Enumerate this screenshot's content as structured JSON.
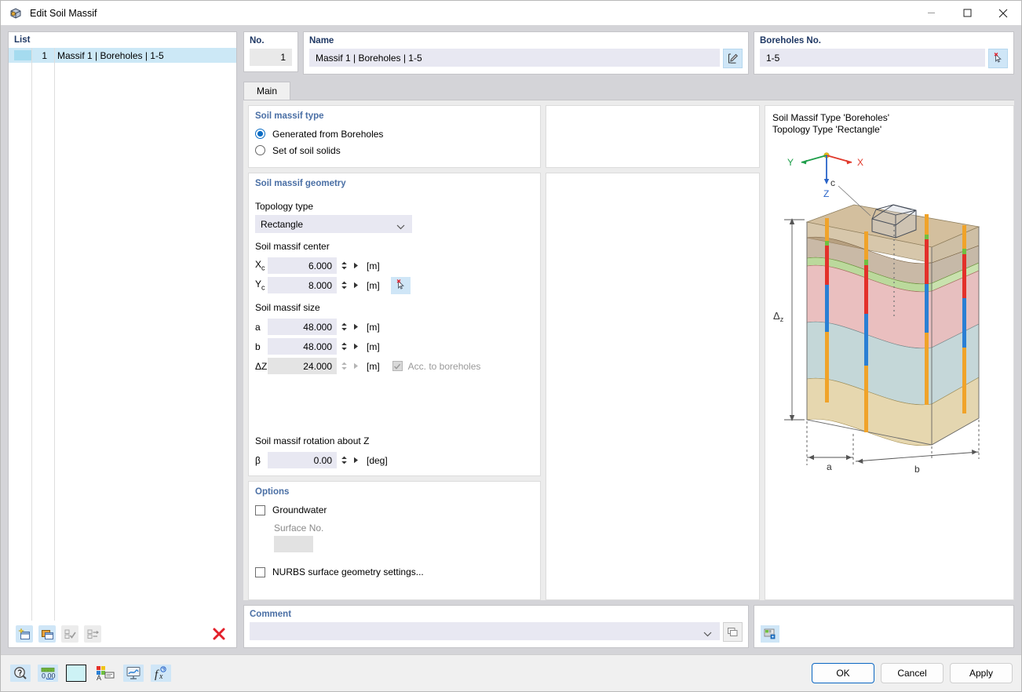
{
  "window": {
    "title": "Edit Soil Massif",
    "icon": "soil-massif-icon",
    "minimize": "—",
    "maximize": "□",
    "close": "✕"
  },
  "list": {
    "header": "List",
    "rows": [
      {
        "no": "1",
        "name": "Massif 1 | Boreholes | 1-5",
        "swatch": "#a5dbef"
      }
    ],
    "toolbar": [
      {
        "name": "new-item-button",
        "enabled": true
      },
      {
        "name": "copy-item-button",
        "enabled": true
      },
      {
        "name": "select-all-button",
        "enabled": false
      },
      {
        "name": "invert-selection-button",
        "enabled": false
      }
    ],
    "delete_button": "delete-item-button"
  },
  "header": {
    "no_label": "No.",
    "no_value": "1",
    "name_label": "Name",
    "name_value": "Massif 1 | Boreholes | 1-5",
    "name_edit_button": "edit-name-button",
    "boreholes_label": "Boreholes No.",
    "boreholes_value": "1-5",
    "boreholes_pick_button": "pick-boreholes-button"
  },
  "tabs": [
    {
      "label": "Main",
      "active": true
    }
  ],
  "soil_massif_type": {
    "title": "Soil massif type",
    "options": [
      {
        "label": "Generated from Boreholes",
        "selected": true
      },
      {
        "label": "Set of soil solids",
        "selected": false
      }
    ]
  },
  "geometry": {
    "title": "Soil massif geometry",
    "topology_label": "Topology type",
    "topology_value": "Rectangle",
    "center_label": "Soil massif center",
    "center": [
      {
        "sym": "X",
        "sub": "c",
        "value": "6.000",
        "unit": "[m]",
        "readonly": false
      },
      {
        "sym": "Y",
        "sub": "c",
        "value": "8.000",
        "unit": "[m]",
        "readonly": false,
        "pick": true
      }
    ],
    "size_label": "Soil massif size",
    "size": [
      {
        "sym": "a",
        "sub": "",
        "value": "48.000",
        "unit": "[m]",
        "readonly": false
      },
      {
        "sym": "b",
        "sub": "",
        "value": "48.000",
        "unit": "[m]",
        "readonly": false
      },
      {
        "sym": "ΔZ",
        "sub": "",
        "value": "24.000",
        "unit": "[m]",
        "readonly": true
      }
    ],
    "acc_to_boreholes_label": "Acc. to boreholes",
    "acc_to_boreholes_checked": true,
    "rotation_label": "Soil massif rotation about Z",
    "rotation": {
      "sym": "β",
      "value": "0.00",
      "unit": "[deg]"
    }
  },
  "options": {
    "title": "Options",
    "groundwater_label": "Groundwater",
    "groundwater_checked": false,
    "surface_no_label": "Surface No.",
    "surface_no_value": "",
    "nurbs_label": "NURBS surface geometry settings...",
    "nurbs_checked": false
  },
  "preview": {
    "line1": "Soil Massif Type 'Boreholes'",
    "line2": "Topology Type 'Rectangle'",
    "axes": {
      "x": "X",
      "y": "Y",
      "z": "Z"
    },
    "annotations": {
      "dz": "Δ",
      "dz_sub": "z",
      "a": "a",
      "b": "b",
      "c": "c"
    },
    "image_button": "preview-image-button"
  },
  "comment": {
    "title": "Comment",
    "value": "",
    "dropdown_button": "comment-dropdown",
    "extra_button": "comment-copy-button"
  },
  "footer": {
    "tools": [
      {
        "name": "help-tool-button"
      },
      {
        "name": "units-tool-button"
      },
      {
        "name": "color-tool-button"
      },
      {
        "name": "display-properties-button"
      },
      {
        "name": "graphic-settings-button"
      },
      {
        "name": "formula-tool-button"
      }
    ],
    "buttons": [
      {
        "label": "OK",
        "primary": true,
        "name": "ok-button"
      },
      {
        "label": "Cancel",
        "primary": false,
        "name": "cancel-button"
      },
      {
        "label": "Apply",
        "primary": false,
        "name": "apply-button"
      }
    ]
  },
  "colors": {
    "accent_blue": "#0a6cc4",
    "panel_title": "#4a6fa5",
    "header_title": "#1f3864",
    "selection": "#cce8f6",
    "field_bg": "#e8e8f2",
    "readonly_bg": "#e4e4e4"
  }
}
